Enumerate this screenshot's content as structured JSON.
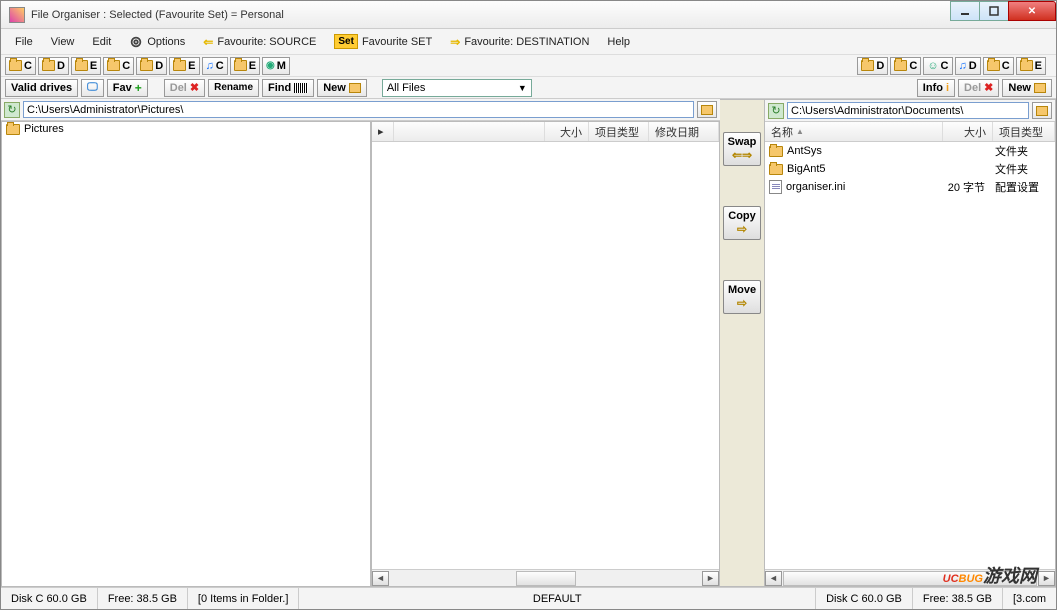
{
  "title": "File Organiser :    Selected (Favourite Set) =  Personal",
  "menu": {
    "file": "File",
    "view": "View",
    "edit": "Edit",
    "options": "Options",
    "fav_source": "Favourite: SOURCE",
    "fav_set": "Favourite SET",
    "fav_dest": "Favourite: DESTINATION",
    "help": "Help",
    "set_badge": "Set"
  },
  "drives_left": [
    "C",
    "D",
    "E",
    "C",
    "D",
    "E",
    "C",
    "E",
    "M"
  ],
  "drives_right": [
    "D",
    "C",
    "C",
    "D",
    "C",
    "E"
  ],
  "actions_left": {
    "valid": "Valid drives",
    "fav": "Fav",
    "del": "Del",
    "rename": "Rename",
    "find": "Find",
    "new": "New"
  },
  "actions_right": {
    "info": "Info",
    "del": "Del",
    "new": "New"
  },
  "filter": {
    "value": "All Files"
  },
  "left_pane": {
    "path": "C:\\Users\\Administrator\\Pictures\\",
    "tree_header": "Pictures"
  },
  "mid_pane": {
    "cols": {
      "ext": "▸",
      "size": "大小",
      "type": "项目类型",
      "date": "修改日期"
    }
  },
  "mid_ctrl": {
    "swap": "Swap",
    "copy": "Copy",
    "move": "Move"
  },
  "right_pane": {
    "path": "C:\\Users\\Administrator\\Documents\\",
    "cols": {
      "name": "名称",
      "size": "大小",
      "type": "项目类型"
    },
    "items": [
      {
        "name": "AntSys",
        "size": "",
        "type": "文件夹",
        "kind": "folder"
      },
      {
        "name": "BigAnt5",
        "size": "",
        "type": "文件夹",
        "kind": "folder"
      },
      {
        "name": "organiser.ini",
        "size": "20 字节",
        "type": "配置设置",
        "kind": "ini"
      }
    ]
  },
  "status": {
    "left_disk": "Disk C 60.0 GB",
    "left_free": "Free: 38.5 GB",
    "left_items": "[0 Items in Folder.]",
    "default": "DEFAULT",
    "right_disk": "Disk C 60.0 GB",
    "right_free": "Free: 38.5 GB",
    "right_items": "[3.com"
  },
  "watermark": {
    "a": "UC",
    "b": "BUG",
    "c": "游戏网"
  }
}
